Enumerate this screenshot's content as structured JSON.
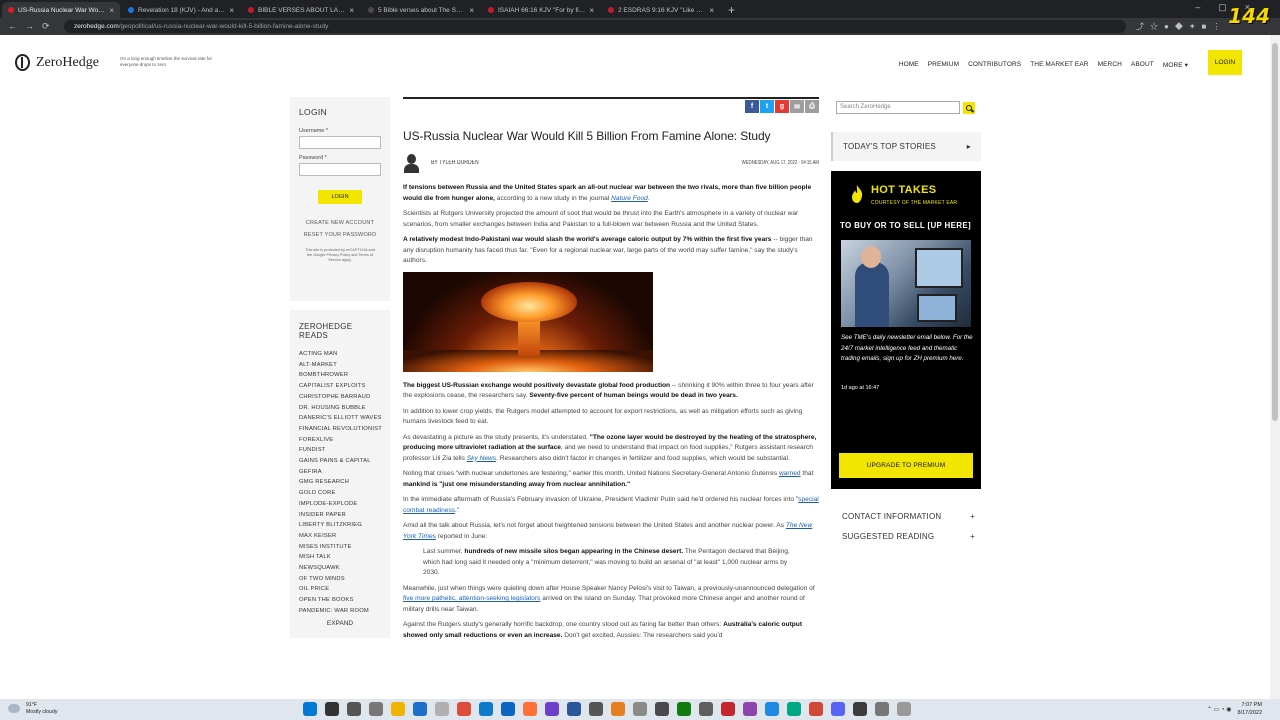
{
  "browser": {
    "tabs": [
      {
        "title": "US-Russia Nuclear War Would Ki...",
        "active": true,
        "color": "#e01b24"
      },
      {
        "title": "Revelation 18 (KJV) - And after th...",
        "active": false,
        "color": "#1a73e8"
      },
      {
        "title": "BIBLE VERSES ABOUT LAKE OF F...",
        "active": false,
        "color": "#c01c28"
      },
      {
        "title": "5 Bible verses about The Second...",
        "active": false,
        "color": "#4a4a4a"
      },
      {
        "title": "ISAIAH 66:16 KJV \"For by fire an...",
        "active": false,
        "color": "#c01c28"
      },
      {
        "title": "2 ESDRAS 9:16 KJV \"Like as a wa...",
        "active": false,
        "color": "#c01c28"
      }
    ],
    "new_tab": "+",
    "url_domain": "zerohedge.com",
    "url_path": "/geopolitical/us-russia-nuclear-war-would-kill-5-billion-famine-alone-study",
    "overlay_counter": "144"
  },
  "site": {
    "logo_name": "ZeroHedge",
    "tagline": "On a long enough timeline the survival rate for everyone drops to zero",
    "nav": [
      "HOME",
      "PREMIUM",
      "CONTRIBUTORS",
      "THE MARKET EAR",
      "MERCH",
      "ABOUT",
      "MORE ▾"
    ],
    "login": "LOGIN"
  },
  "left": {
    "login_title": "LOGIN",
    "username_label": "Username *",
    "password_label": "Password *",
    "login_button": "LOGIN",
    "create_account": "CREATE NEW ACCOUNT",
    "reset_password": "RESET YOUR PASSWORD",
    "captcha_note": "This site is protected by reCAPTCHA and the Google Privacy Policy and Terms of Service apply.",
    "reads_title": "ZEROHEDGE READS",
    "reads": [
      "ACTING MAN",
      "ALT-MARKET",
      "BOMBTHROWER",
      "CAPITALIST EXPLOITS",
      "CHRISTOPHE BARRAUD",
      "DR. HOUSING BUBBLE",
      "DANERIC'S ELLIOTT WAVES",
      "FINANCIAL REVOLUTIONIST",
      "FOREXLIVE",
      "FUNDIST",
      "GAINS PAINS & CAPITAL",
      "GEFIRA",
      "GMG RESEARCH",
      "GOLD CORE",
      "IMPLODE-EXPLODE",
      "INSIDER PAPER",
      "LIBERTY BLITZKRIEG",
      "MAX KEISER",
      "MISES INSTITUTE",
      "MISH TALK",
      "NEWSQUAWK",
      "OF TWO MINDS",
      "OIL PRICE",
      "OPEN THE BOOKS",
      "PANDEMIC: WAR ROOM"
    ],
    "expand": "EXPAND"
  },
  "article": {
    "share": [
      {
        "label": "f",
        "color": "#3b5998"
      },
      {
        "label": "t",
        "color": "#1da1f2"
      },
      {
        "label": "g",
        "color": "#e53935"
      },
      {
        "label": "✉",
        "color": "#9e9e9e"
      },
      {
        "label": "⎙",
        "color": "#9e9e9e"
      }
    ],
    "headline": "US-Russia Nuclear War Would Kill 5 Billion From Famine Alone: Study",
    "author": "BY TYLER DURDEN",
    "date": "WEDNESDAY, AUG 17, 2022 - 04:15 AM",
    "p1_bold": "If tensions between Russia and the United States spark an all-out nuclear war between the two rivals, more than five billion people would die from hunger alone,",
    "p1_rest": " according to a new study in the journal ",
    "p1_link": "Nature Food",
    "p1_end": ".",
    "p2": "Scientists at Rutgers University projected the amount of soot that would be thrust into the Earth's atmosphere in a variety of nuclear war scenarios, from smaller exchanges between India and Pakistan to a full-blown war between Russia and the United States.",
    "p3_bold": "A relatively modest Indo-Pakistani war would slash the world's average caloric output by 7% within the first five years",
    "p3_rest": " -- bigger than any disruption humanity has faced thus far. \"Even for a regional nuclear war, large parts of the world may suffer famine,\" say the study's authors.",
    "p4_bold": "The biggest US-Russian exchange would positively devastate global food production",
    "p4_rest": " -- shrinking it 90% within three to four years after the explosions cease, the researchers say. ",
    "p4_bold2": "Seventy-five percent of human beings would be dead in two years.",
    "p5": "In addition to lower crop yields, the Rutgers model attempted to account for export restrictions, as well as mitigation efforts such as giving humans livestock feed to eat.",
    "p6_a": "As devastating a picture as the study presents, it's understated. ",
    "p6_bold": "\"The ozone layer would be destroyed by the heating of the stratosphere, producing more ultraviolet radiation at the surface",
    "p6_b": ", and we need to understand that impact on food supplies,\" Rutgers assistant research professor Lili Zia tells ",
    "p6_link": "Sky News",
    "p6_c": ". Researchers also didn't factor in changes in fertilizer and food supplies, which would be substantial.",
    "p7_a": "Noting that crises \"with nuclear undertones are festering,\" earlier this month, United Nations Secretary-General Antonio Guterres ",
    "p7_link": "warned",
    "p7_b": " that ",
    "p7_bold": "mankind is \"just one misunderstanding away from nuclear annihilation.\"",
    "p8_a": "In the immediate aftermath of Russia's February invasion of Ukraine, President Vladimir Putin said he'd ordered his nuclear forces into \"",
    "p8_link": "special combat readiness",
    "p8_b": ".\"",
    "p9_a": "Amid all the talk about Russia, let's not forget about heightened tensions between the United States and another nuclear power. As ",
    "p9_link": "The New York Times",
    "p9_b": " reported in June:",
    "q_a": "Last summer, ",
    "q_bold": "hundreds of new missile silos began appearing in the Chinese desert.",
    "q_b": " The Pentagon declared that Beijing, which had long said it needed only a \"minimum deterrent,\" was moving to build an arsenal of \"at least\" 1,000 nuclear arms by 2030.",
    "p10_a": "Meanwhile, just when things were quieting down after House Speaker Nancy Pelosi's visit to Taiwan, a previously-unannounced delegation of ",
    "p10_link": "five more pathetic, attention-seeking legislators",
    "p10_b": " arrived on the island on Sunday. That provoked more Chinese anger and another round of military drills near Taiwan.",
    "p11_a": "Against the Rutgers study's generally horrific backdrop, one country stood out as faring far better than others: ",
    "p11_bold": "Australia's caloric output showed only small reductions or even an increase.",
    "p11_b": " Don't get excited, Aussies: The researchers said you'd"
  },
  "right": {
    "search_placeholder": "Search ZeroHedge",
    "top_stories": "TODAY'S TOP STORIES",
    "top_stories_toggle": "▸",
    "hot_takes_title": "HOT TAKES",
    "hot_takes_sub": "COURTESY OF THE MARKET EAR",
    "hot_takes_headline": "TO BUY OR TO SELL [UP HERE]",
    "hot_takes_text": "See TME's daily newsletter email below. For the 24/7 market intelligence feed and thematic trading emails, sign up for ZH premium here.",
    "hot_takes_time": "1d ago at 16:47",
    "upgrade": "UPGRADE TO PREMIUM",
    "contact": "CONTACT INFORMATION",
    "suggested": "SUGGESTED READING",
    "plus": "+"
  },
  "taskbar": {
    "temp": "91°F",
    "condition": "Mostly cloudy",
    "time": "7:07 PM",
    "date": "8/17/2022",
    "app_colors": [
      "#0078d4",
      "#333",
      "#555",
      "#777",
      "#f0b400",
      "#1f6fc9",
      "#b0b0b0",
      "#dd4b39",
      "#0f7acc",
      "#0a66c2",
      "#ff7139",
      "#6e40c9",
      "#2b579a",
      "#555",
      "#e67e22",
      "#8a8a8a",
      "#4a4a4a",
      "#107c10",
      "#5e5e5e",
      "#c4262e",
      "#8e44ad",
      "#1e88e5",
      "#00a884",
      "#d14836",
      "#5865f2",
      "#3c3c3c",
      "#777",
      "#999"
    ]
  }
}
